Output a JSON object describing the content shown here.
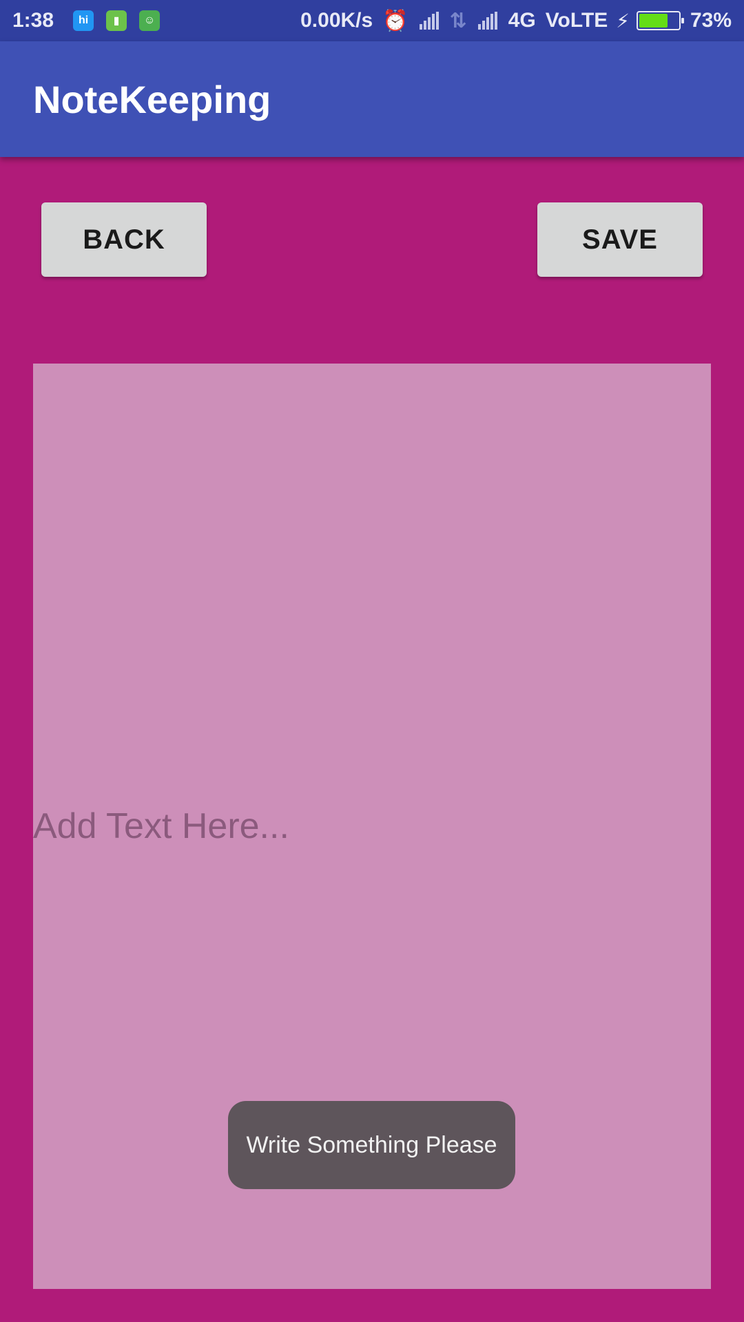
{
  "status_bar": {
    "time": "1:38",
    "app_icons": [
      "hi-icon",
      "battery-app-icon",
      "cat-app-icon"
    ],
    "hi_icon_label": "hi",
    "network_speed": "0.00K/s",
    "network_type": "4G",
    "volte": "VoLTE",
    "battery_percent": "73%",
    "battery_level": 0.73
  },
  "app_bar": {
    "title": "NoteKeeping"
  },
  "buttons": {
    "back_label": "BACK",
    "save_label": "SAVE"
  },
  "note": {
    "placeholder": "Add Text Here..."
  },
  "toast": {
    "message": "Write Something Please"
  },
  "colors": {
    "background": "#B01B79",
    "app_bar": "#3F51B5",
    "status_bar": "#303F9F",
    "note_area": "#CD8FB9",
    "button": "#D6D7D7",
    "toast": "#5E555B"
  }
}
